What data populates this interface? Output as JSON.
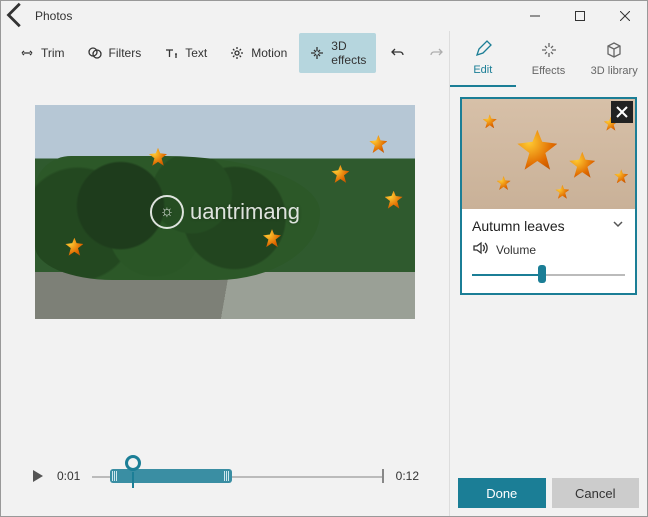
{
  "window": {
    "title": "Photos"
  },
  "toolbar": {
    "trim": "Trim",
    "filters": "Filters",
    "text": "Text",
    "motion": "Motion",
    "effects3d": "3D effects"
  },
  "timeline": {
    "current": "0:01",
    "duration": "0:12"
  },
  "watermark": {
    "text": "uantrimang"
  },
  "rightTabs": {
    "edit": "Edit",
    "effects": "Effects",
    "library": "3D library"
  },
  "effectCard": {
    "name": "Autumn leaves",
    "volumeLabel": "Volume",
    "volumePercent": 46
  },
  "footer": {
    "done": "Done",
    "cancel": "Cancel"
  },
  "colors": {
    "accent": "#1b7e96"
  }
}
